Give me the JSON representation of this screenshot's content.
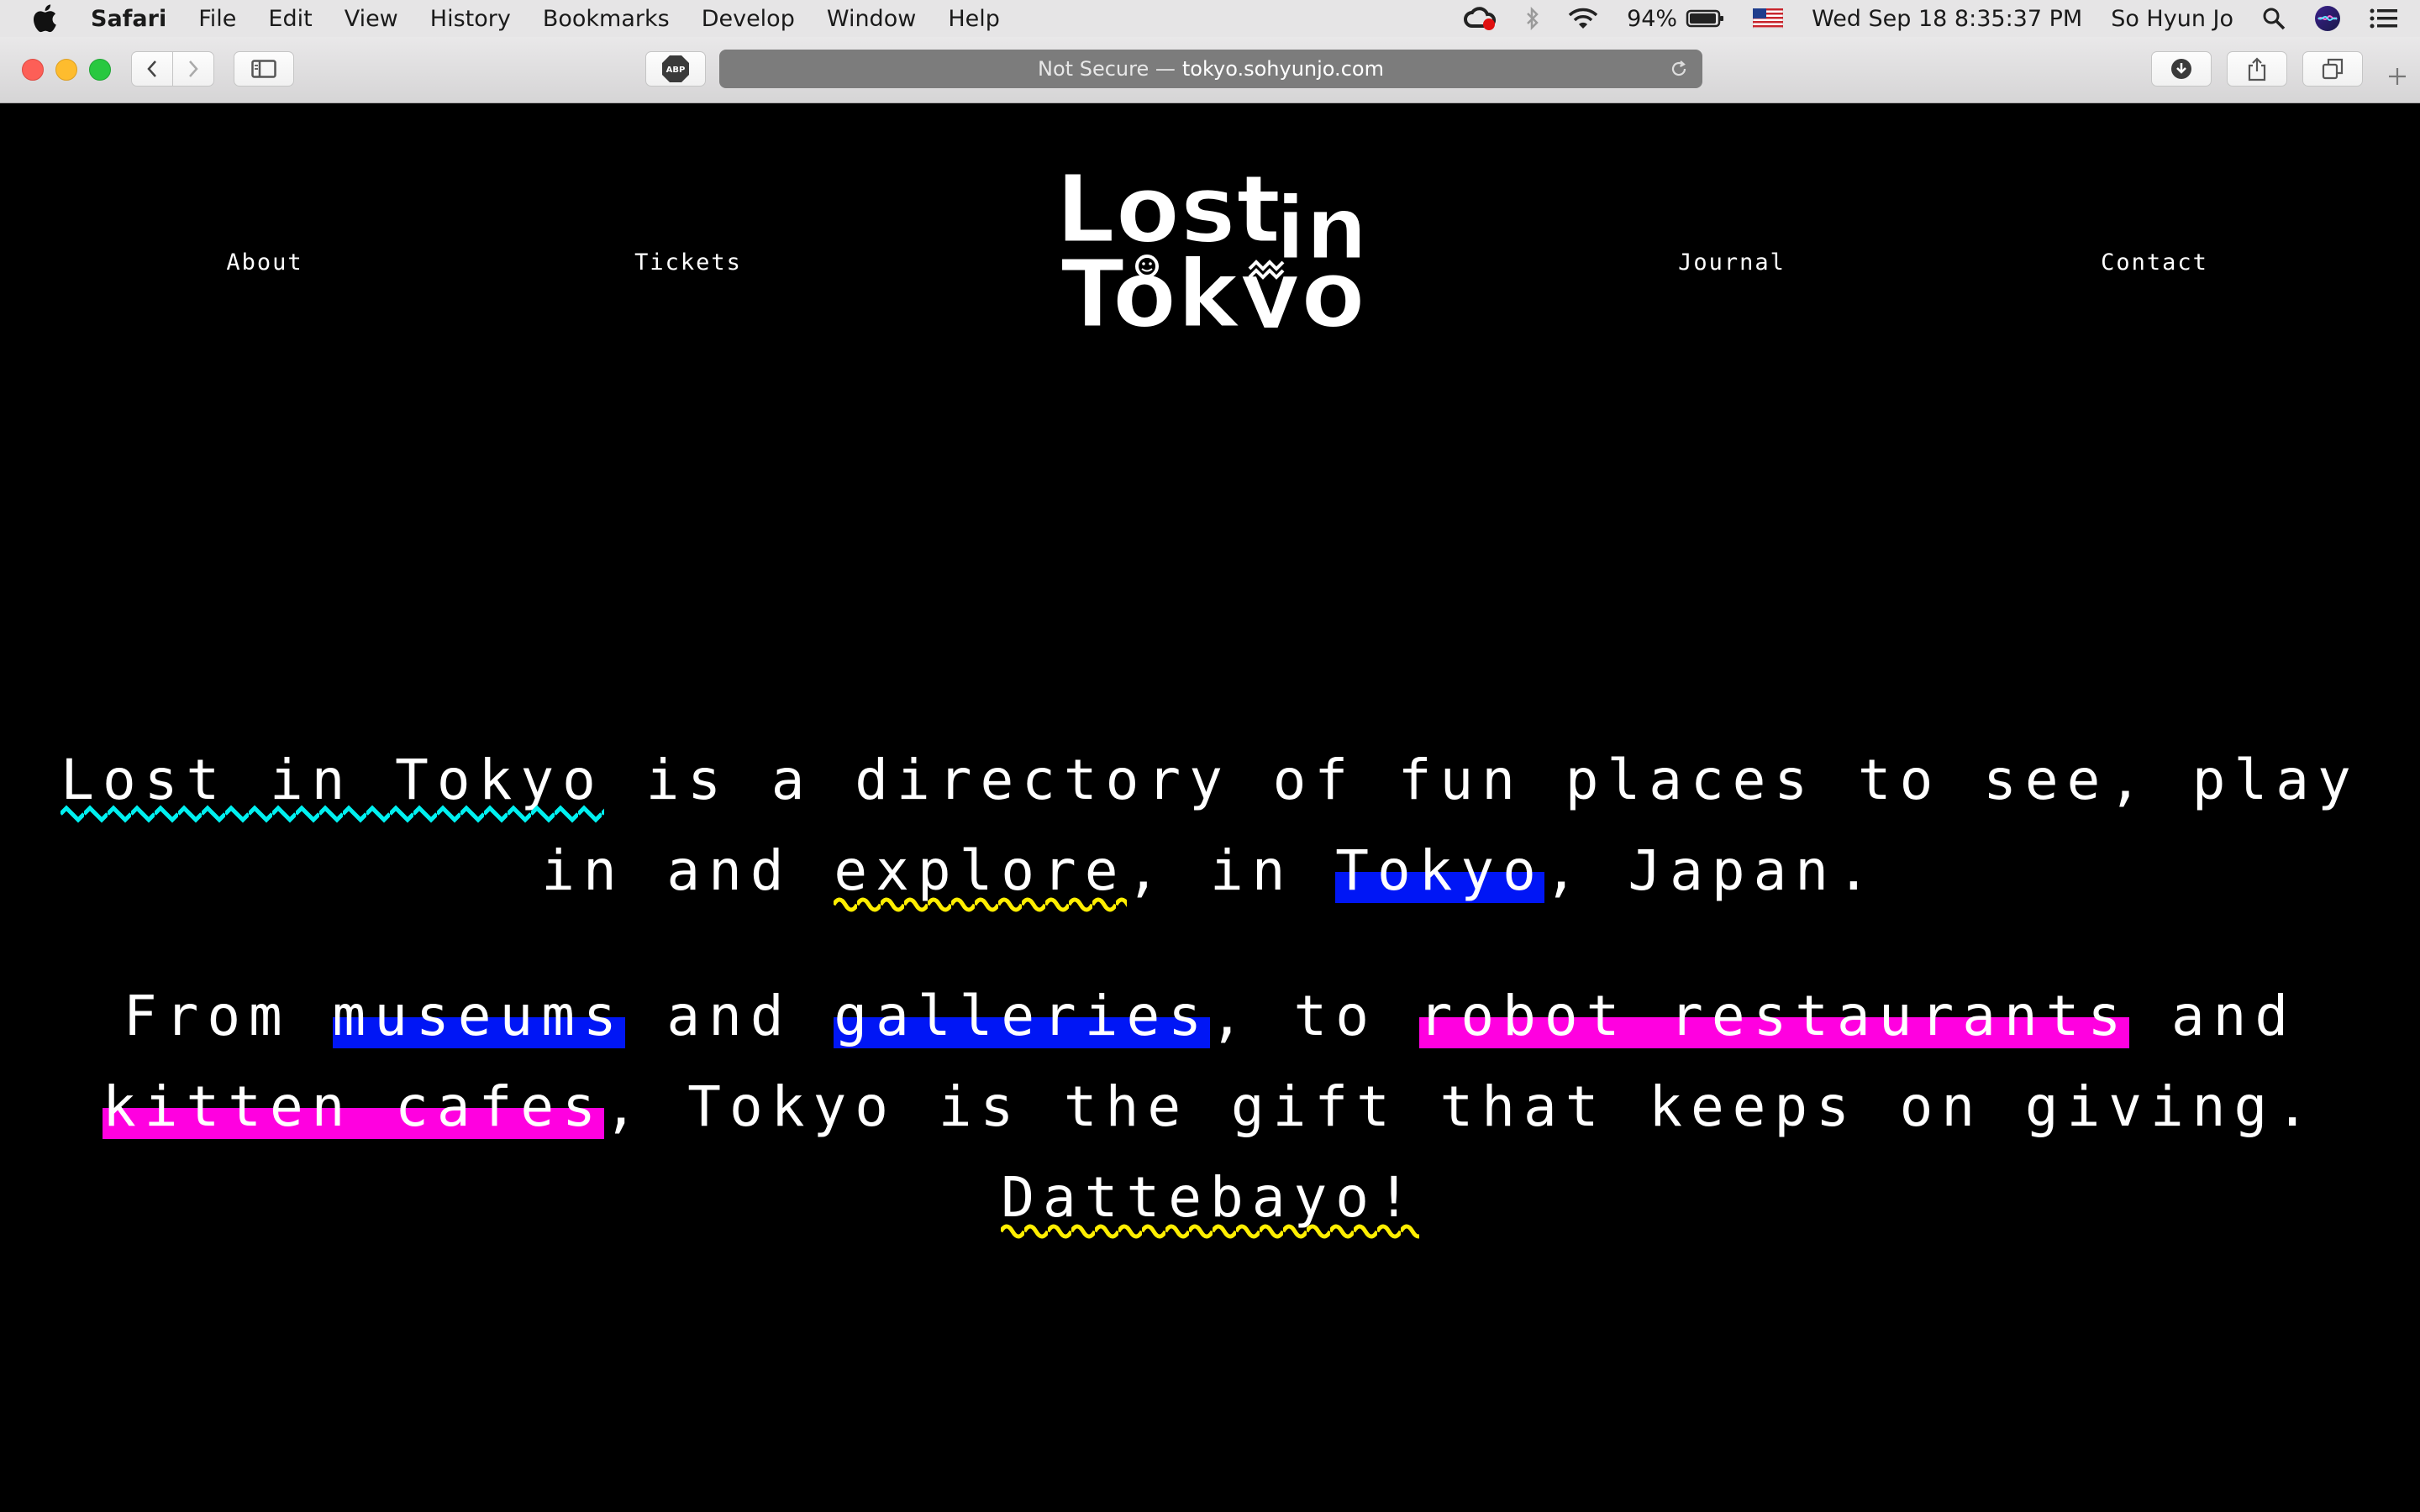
{
  "menubar": {
    "app_name": "Safari",
    "items": [
      "File",
      "Edit",
      "View",
      "History",
      "Bookmarks",
      "Develop",
      "Window",
      "Help"
    ],
    "battery": "94%",
    "datetime": "Wed Sep 18  8:35:37 PM",
    "user": "So Hyun Jo"
  },
  "browser": {
    "security_label": "Not Secure —",
    "host": "tokyo.sohyunjo.com",
    "extension_label": "ABP"
  },
  "site": {
    "nav_left": [
      "About",
      "Tickets"
    ],
    "nav_right": [
      "Journal",
      "Contact"
    ],
    "logo_line1": "Lost",
    "logo_line1b": "in",
    "logo_line2": "Tokyo"
  },
  "intro": {
    "p1": {
      "lost_in_tokyo": "Lost in Tokyo",
      "text_a": " is a directory of fun places to see, play in and ",
      "explore": "explore",
      "text_b": ", in ",
      "tokyo": "Tokyo",
      "text_c": ", Japan."
    },
    "p2": {
      "text_a": "From ",
      "museums": "museums",
      "text_b": " and ",
      "galleries": "galleries",
      "text_c": ", to ",
      "robot_restaurants": "robot restaurants",
      "text_d": " and ",
      "kitten_cafes": "kitten cafes",
      "text_e": ", Tokyo is the gift that keeps on giving. ",
      "dattebayo": "Dattebayo!"
    }
  },
  "colors": {
    "highlight_blue": "#0016f5",
    "highlight_pink": "#ff00e0",
    "wave_cyan": "#00f0f0",
    "wave_yellow": "#ffee00"
  }
}
